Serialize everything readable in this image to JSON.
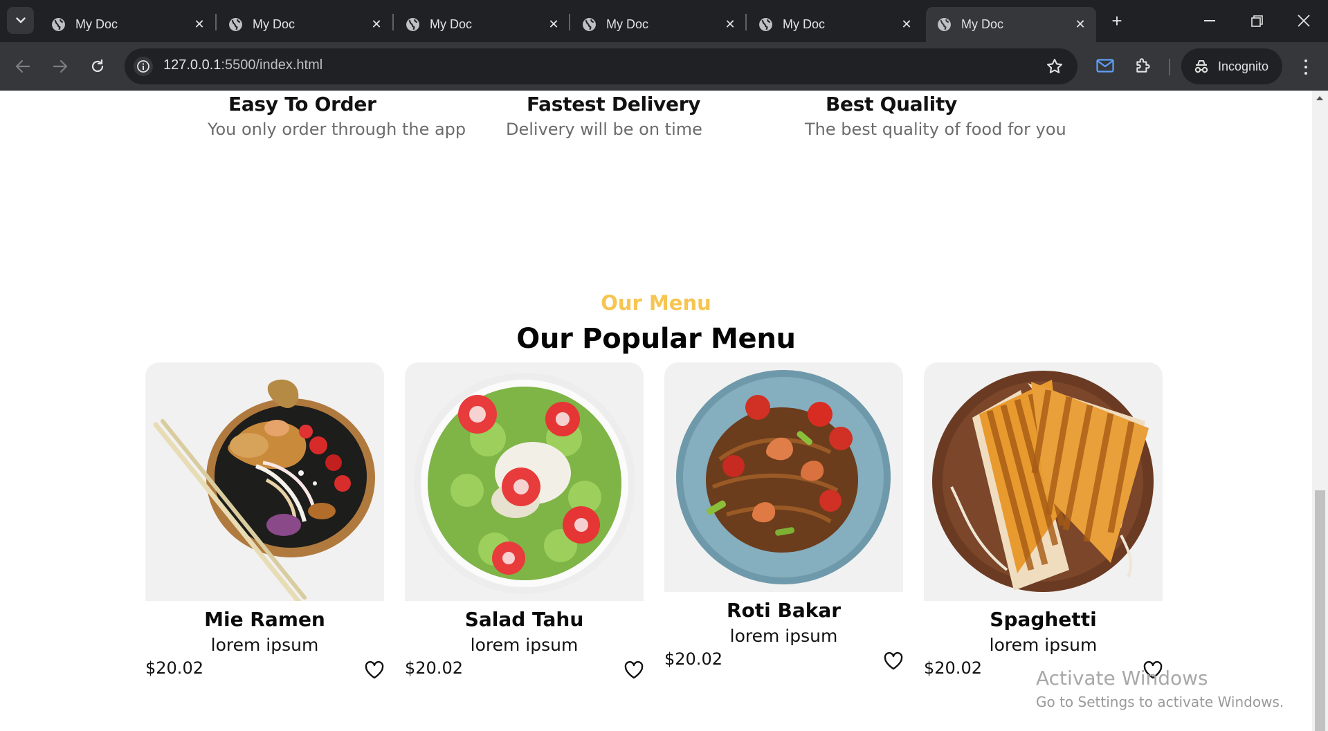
{
  "browser": {
    "tabs": [
      {
        "title": "My Doc",
        "active": false
      },
      {
        "title": "My Doc",
        "active": false
      },
      {
        "title": "My Doc",
        "active": false
      },
      {
        "title": "My Doc",
        "active": false
      },
      {
        "title": "My Doc",
        "active": false
      },
      {
        "title": "My Doc",
        "active": true
      }
    ],
    "url_host": "127.0.0.1",
    "url_rest": ":5500/index.html",
    "incognito_label": "Incognito"
  },
  "features": [
    {
      "title": "Easy To Order",
      "text": "You only order through the app"
    },
    {
      "title": "Fastest Delivery",
      "text": "Delivery will be on time"
    },
    {
      "title": "Best Quality",
      "text": "The best quality of food for you"
    }
  ],
  "menu": {
    "kicker": "Our Menu",
    "heading": "Our Popular Menu",
    "items": [
      {
        "name": "Mie Ramen",
        "desc": "lorem ipsum",
        "price": "$20.02"
      },
      {
        "name": "Salad Tahu",
        "desc": "lorem ipsum",
        "price": "$20.02"
      },
      {
        "name": "Roti Bakar",
        "desc": "lorem ipsum",
        "price": "$20.02"
      },
      {
        "name": "Spaghetti",
        "desc": "lorem ipsum",
        "price": "$20.02"
      }
    ]
  },
  "watermark": {
    "line1": "Activate Windows",
    "line2": "Go to Settings to activate Windows."
  }
}
